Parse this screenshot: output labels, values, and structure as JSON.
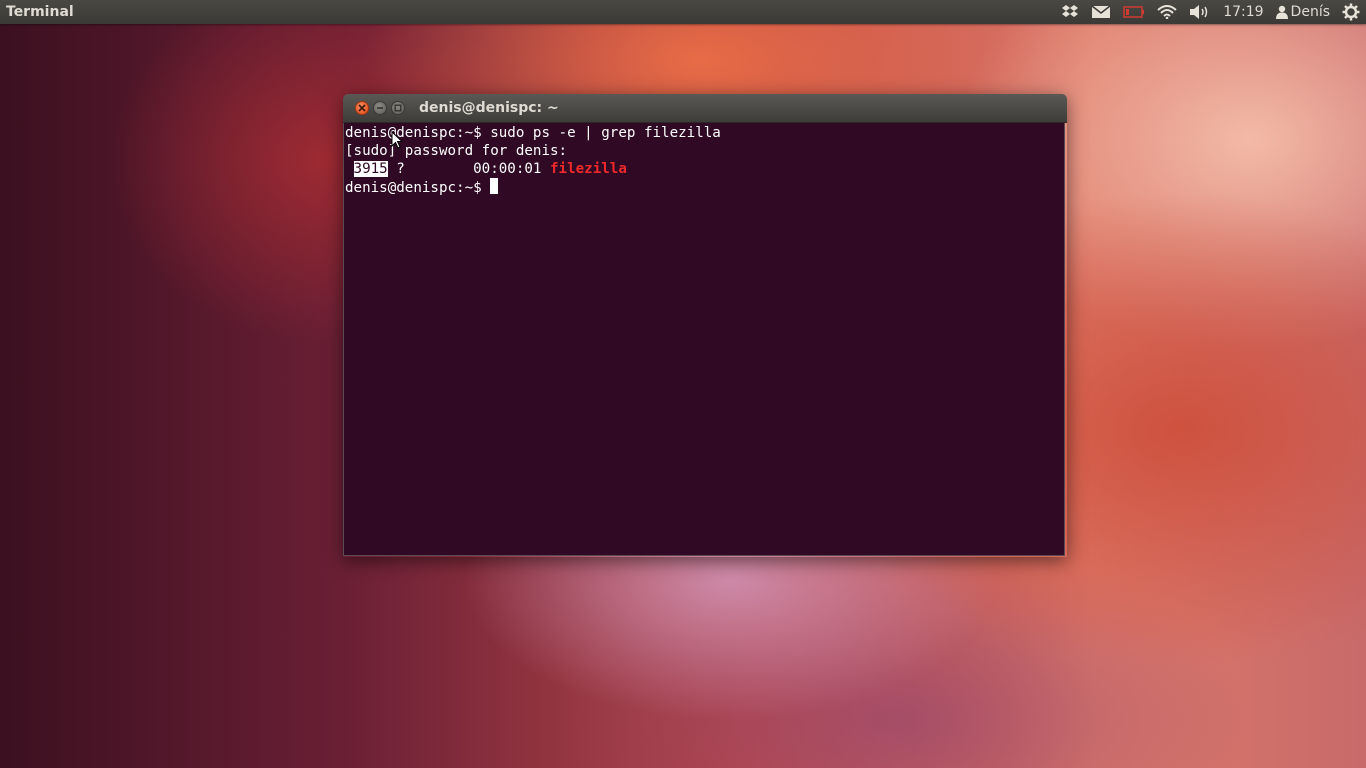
{
  "panel": {
    "app_title": "Terminal",
    "indicators": [
      "dropbox-icon",
      "mail-icon",
      "battery-icon",
      "wifi-icon",
      "volume-icon"
    ],
    "clock": "17:19",
    "user": "Denís",
    "session_icon": "gear-icon"
  },
  "window": {
    "title": "denis@denispc: ~",
    "buttons": [
      "close",
      "minimize",
      "maximize"
    ]
  },
  "terminal": {
    "line1": "denis@denispc:~$ sudo ps -e | grep filezilla",
    "line2": "[sudo] password for denis:",
    "pid_pad": " ",
    "pid": "3915",
    "tty_time": " ?        00:00:01 ",
    "process": "filezilla",
    "prompt": "denis@denispc:~$ "
  },
  "colors": {
    "terminal_bg": "#300a24",
    "highlight": "#ef2929",
    "panel_bg": "#3b3a36"
  }
}
